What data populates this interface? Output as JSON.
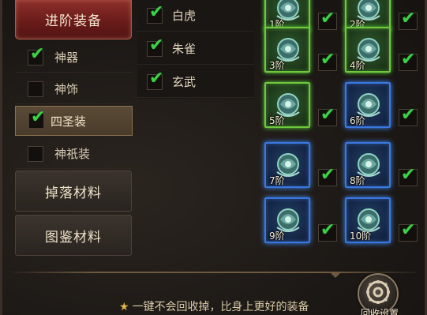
{
  "left_panel": {
    "top_button": "进阶装备",
    "sub_items": [
      {
        "label": "神器",
        "checked": true,
        "selected": false
      },
      {
        "label": "神饰",
        "checked": false,
        "selected": false
      },
      {
        "label": "四圣装",
        "checked": true,
        "selected": true
      },
      {
        "label": "神祇装",
        "checked": false,
        "selected": false
      }
    ],
    "drop_materials": "掉落材料",
    "codex_materials": "图鉴材料"
  },
  "middle_panel": {
    "items": [
      {
        "label": "白虎",
        "checked": true
      },
      {
        "label": "朱雀",
        "checked": true
      },
      {
        "label": "玄武",
        "checked": true
      }
    ]
  },
  "grid": {
    "tiles": [
      {
        "label": "1阶",
        "quality": "green",
        "checked": true
      },
      {
        "label": "2阶",
        "quality": "green",
        "checked": true
      },
      {
        "label": "3阶",
        "quality": "green",
        "checked": true
      },
      {
        "label": "4阶",
        "quality": "green",
        "checked": true
      },
      {
        "label": "5阶",
        "quality": "green",
        "checked": true
      },
      {
        "label": "6阶",
        "quality": "blue",
        "checked": true
      },
      {
        "label": "7阶",
        "quality": "blue",
        "checked": true
      },
      {
        "label": "8阶",
        "quality": "blue",
        "checked": true
      },
      {
        "label": "9阶",
        "quality": "blue",
        "checked": true
      },
      {
        "label": "10阶",
        "quality": "blue",
        "checked": true
      }
    ]
  },
  "footer": {
    "star_icon": "★",
    "note": "一键不会回收掉，比身上更好的装备",
    "recycle_button_label": "回收设置"
  },
  "colors": {
    "check_green": "#3fd04a",
    "tile_green": "#6ec83e",
    "tile_blue": "#3a78e0",
    "top_button_red": "#8e2f2b"
  }
}
